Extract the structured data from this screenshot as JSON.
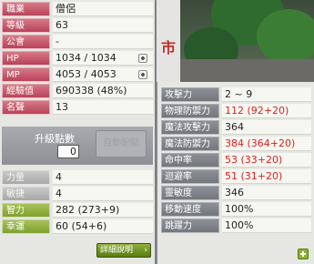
{
  "stats": [
    {
      "label": "職業",
      "value": "僧侶",
      "style": "red",
      "plus": false
    },
    {
      "label": "等級",
      "value": "63",
      "style": "red",
      "plus": false
    },
    {
      "label": "公會",
      "value": "-",
      "style": "red",
      "plus": false
    },
    {
      "label": "HP",
      "value": "1034 / 1034",
      "style": "red",
      "plus": true
    },
    {
      "label": "MP",
      "value": "4053 / 4053",
      "style": "red",
      "plus": true
    },
    {
      "label": "經驗值",
      "value": "690338 (48%)",
      "style": "red",
      "plus": false
    },
    {
      "label": "名聲",
      "value": "13",
      "style": "red",
      "plus": false
    }
  ],
  "ap": {
    "label": "升級點數",
    "value": "0",
    "auto_label": "自動配點"
  },
  "attributes": [
    {
      "label": "力量",
      "value": "4",
      "style": "gray"
    },
    {
      "label": "敏捷",
      "value": "4",
      "style": "gray"
    },
    {
      "label": "智力",
      "value": "282 (273+9)",
      "style": "green"
    },
    {
      "label": "幸運",
      "value": "60 (54+6)",
      "style": "green"
    }
  ],
  "detail_button": "詳細說明",
  "scene_sign": "市",
  "details": [
    {
      "label": "攻擊力",
      "value": "2 ~ 9",
      "red": false
    },
    {
      "label": "物理防禦力",
      "value": "112 (92+20)",
      "red": true
    },
    {
      "label": "魔法攻擊力",
      "value": "364",
      "red": false
    },
    {
      "label": "魔法防禦力",
      "value": "384 (364+20)",
      "red": true
    },
    {
      "label": "命中率",
      "value": "53 (33+20)",
      "red": true
    },
    {
      "label": "迴避率",
      "value": "51 (31+20)",
      "red": true
    },
    {
      "label": "靈敏度",
      "value": "346",
      "red": false
    },
    {
      "label": "移動速度",
      "value": "100%",
      "red": false
    },
    {
      "label": "跳躍力",
      "value": "100%",
      "red": false
    }
  ],
  "colors": {
    "red_value": "#e0201c",
    "green_button": "#7fa02d"
  }
}
